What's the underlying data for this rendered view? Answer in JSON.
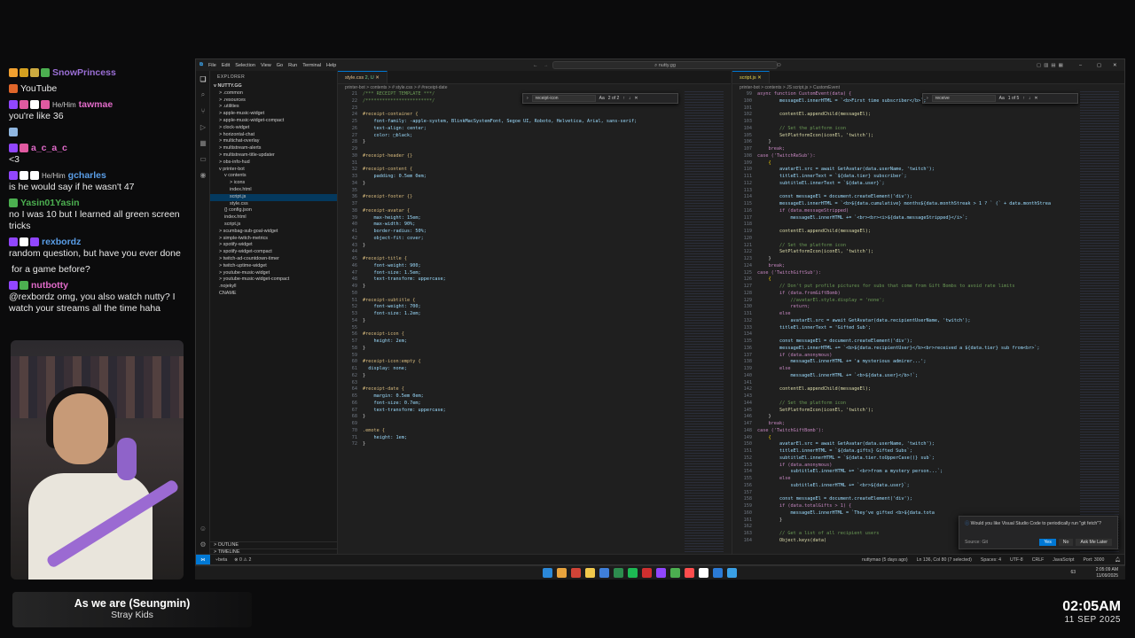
{
  "chat": [
    {
      "user": "SnowPrincess",
      "color": "#9b6fd6",
      "pronouns": "",
      "badges": [
        "#f0a030",
        "#d4a020",
        "#ccaa40",
        "#4caf50"
      ],
      "text": ""
    },
    {
      "user": "",
      "color": "#ffffff",
      "pronouns": "",
      "badges": [
        "#e0662a"
      ],
      "text": "YouTube"
    },
    {
      "user": "tawmae",
      "color": "#e06ac8",
      "pronouns": "He/Him",
      "badges": [
        "#9146ff",
        "#e05aa0",
        "#ffffff",
        "#e05aa0"
      ],
      "text": "you're like 36"
    },
    {
      "user": "",
      "color": "#ffffff",
      "pronouns": "",
      "badges": [
        "#8fb6e0"
      ],
      "text": ""
    },
    {
      "user": "a_c_a_c",
      "color": "#e06ac8",
      "pronouns": "",
      "badges": [
        "#9146ff",
        "#e05aa0"
      ],
      "text": "<3"
    },
    {
      "user": "gcharles",
      "color": "#5a9ee8",
      "pronouns": "He/Him",
      "badges": [
        "#9146ff",
        "#ffffff",
        "#ffffff"
      ],
      "text": "is  he would say if he wasn't 47"
    },
    {
      "user": "Yasin01Yasin",
      "color": "#4caf50",
      "pronouns": "",
      "badges": [
        "#4caf50"
      ],
      "text": "no I was 10 but I learned all green screen tricks"
    },
    {
      "user": "rexbordz",
      "color": "#5a9ee8",
      "pronouns": "",
      "badges": [
        "#9146ff",
        "#ffffff",
        "#9146ff"
      ],
      "text": "random question, but have you ever done"
    },
    {
      "user": "",
      "color": "#ffffff",
      "pronouns": "",
      "badges": [],
      "text": "for a game before?"
    },
    {
      "user": "nutbotty",
      "color": "#e06ac8",
      "pronouns": "",
      "badges": [
        "#9146ff",
        "#4caf50"
      ],
      "text": "@rexbordz omg, you also watch nutty? I watch your streams all the time haha"
    }
  ],
  "now_playing": {
    "title": "As we are (Seungmin)",
    "artist": "Stray Kids"
  },
  "clock": {
    "time": "02:05AM",
    "date": "11 SEP 2025"
  },
  "vscode": {
    "menu": [
      "File",
      "Edit",
      "Selection",
      "View",
      "Go",
      "Run",
      "Terminal",
      "Help"
    ],
    "search": "nutty.gg",
    "explorer_title": "EXPLORER",
    "root": "NUTTY.GG",
    "tree": [
      {
        "label": "> .common",
        "depth": 1
      },
      {
        "label": "> .resources",
        "depth": 1
      },
      {
        "label": "> .utilities",
        "depth": 1
      },
      {
        "label": "> apple-music-widget",
        "depth": 1
      },
      {
        "label": "> apple-music-widget-compact",
        "depth": 1
      },
      {
        "label": "> clock-widget",
        "depth": 1
      },
      {
        "label": "> horizontal-chat",
        "depth": 1
      },
      {
        "label": "> multichat-overlay",
        "depth": 1
      },
      {
        "label": "> multistream-alerts",
        "depth": 1
      },
      {
        "label": "> multistream-title-updater",
        "depth": 1
      },
      {
        "label": "> obs-info-hud",
        "depth": 1
      },
      {
        "label": "v printer-bot",
        "depth": 1
      },
      {
        "label": "v contents",
        "depth": 2
      },
      {
        "label": "> icons",
        "depth": 3
      },
      {
        "label": "index.html",
        "depth": 3
      },
      {
        "label": "script.js",
        "depth": 3,
        "sel": true
      },
      {
        "label": "style.css",
        "depth": 3
      },
      {
        "label": "{} config.json",
        "depth": 2
      },
      {
        "label": "index.html",
        "depth": 2
      },
      {
        "label": "script.js",
        "depth": 2
      },
      {
        "label": "> scumbag-sub-goal-widget",
        "depth": 1
      },
      {
        "label": "> simple-twitch-metrics",
        "depth": 1
      },
      {
        "label": "> spotify-widget",
        "depth": 1
      },
      {
        "label": "> spotify-widget-compact",
        "depth": 1
      },
      {
        "label": "> twitch-ad-countdown-timer",
        "depth": 1
      },
      {
        "label": "> twitch-uptime-widget",
        "depth": 1
      },
      {
        "label": "> youtube-music-widget",
        "depth": 1
      },
      {
        "label": "> youtube-music-widget-compact",
        "depth": 1
      },
      {
        "label": ".nojekyll",
        "depth": 1
      },
      {
        "label": "CNAME",
        "depth": 1
      }
    ],
    "outline": "OUTLINE",
    "timeline": "TIMELINE",
    "left_editor": {
      "tab": "style.css",
      "tab_status": "2, U",
      "breadcrumb": "printer-bot > contents > # style.css > # #receipt-date",
      "find": {
        "query": "receipt-icon",
        "count": "2 of 2"
      },
      "lines": [
        {
          "n": "21",
          "t": "/*** RECEIPT TEMPLATE ***/",
          "c": "cmt"
        },
        {
          "n": "22",
          "t": "/************************/",
          "c": "cmt"
        },
        {
          "n": "23",
          "t": "",
          "c": ""
        },
        {
          "n": "24",
          "t": "#receipt-container {",
          "c": "sel_"
        },
        {
          "n": "25",
          "t": "    font-family: -apple-system, BlinkMacSystemFont, Segoe UI, Roboto, Helvetica, Arial, sans-serif;",
          "c": "prop"
        },
        {
          "n": "26",
          "t": "    text-align: center;",
          "c": "prop"
        },
        {
          "n": "27",
          "t": "    color: □black;",
          "c": "prop"
        },
        {
          "n": "28",
          "t": "}",
          "c": ""
        },
        {
          "n": "29",
          "t": "",
          "c": ""
        },
        {
          "n": "30",
          "t": "#receipt-header {}",
          "c": "sel_"
        },
        {
          "n": "31",
          "t": "",
          "c": ""
        },
        {
          "n": "32",
          "t": "#receipt-content {",
          "c": "sel_"
        },
        {
          "n": "33",
          "t": "    padding: 0.5em 0em;",
          "c": "prop"
        },
        {
          "n": "34",
          "t": "}",
          "c": ""
        },
        {
          "n": "35",
          "t": "",
          "c": ""
        },
        {
          "n": "36",
          "t": "#receipt-footer {}",
          "c": "sel_"
        },
        {
          "n": "37",
          "t": "",
          "c": ""
        },
        {
          "n": "38",
          "t": "#receipt-avatar {",
          "c": "sel_"
        },
        {
          "n": "39",
          "t": "    max-height: 15em;",
          "c": "prop"
        },
        {
          "n": "40",
          "t": "    max-width: 90%;",
          "c": "prop"
        },
        {
          "n": "41",
          "t": "    border-radius: 50%;",
          "c": "prop"
        },
        {
          "n": "42",
          "t": "    object-fit: cover;",
          "c": "prop"
        },
        {
          "n": "43",
          "t": "}",
          "c": ""
        },
        {
          "n": "44",
          "t": "",
          "c": ""
        },
        {
          "n": "45",
          "t": "#receipt-title {",
          "c": "sel_"
        },
        {
          "n": "46",
          "t": "    font-weight: 900;",
          "c": "prop"
        },
        {
          "n": "47",
          "t": "    font-size: 1.5em;",
          "c": "prop"
        },
        {
          "n": "48",
          "t": "    text-transform: uppercase;",
          "c": "prop"
        },
        {
          "n": "49",
          "t": "}",
          "c": ""
        },
        {
          "n": "50",
          "t": "",
          "c": ""
        },
        {
          "n": "51",
          "t": "#receipt-subtitle {",
          "c": "sel_"
        },
        {
          "n": "52",
          "t": "    font-weight: 700;",
          "c": "prop"
        },
        {
          "n": "53",
          "t": "    font-size: 1.2em;",
          "c": "prop"
        },
        {
          "n": "54",
          "t": "}",
          "c": ""
        },
        {
          "n": "55",
          "t": "",
          "c": ""
        },
        {
          "n": "56",
          "t": "#receipt-icon {",
          "c": "sel_"
        },
        {
          "n": "57",
          "t": "    height: 2em;",
          "c": "prop"
        },
        {
          "n": "58",
          "t": "}",
          "c": ""
        },
        {
          "n": "59",
          "t": "",
          "c": ""
        },
        {
          "n": "60",
          "t": "#receipt-icon:empty {",
          "c": "sel_"
        },
        {
          "n": "61",
          "t": "  display: none;",
          "c": "prop"
        },
        {
          "n": "62",
          "t": "}",
          "c": ""
        },
        {
          "n": "63",
          "t": "",
          "c": ""
        },
        {
          "n": "64",
          "t": "#receipt-date {",
          "c": "sel_"
        },
        {
          "n": "65",
          "t": "    margin: 0.5em 0em;",
          "c": "prop"
        },
        {
          "n": "66",
          "t": "    font-size: 0.7em;",
          "c": "prop"
        },
        {
          "n": "67",
          "t": "    text-transform: uppercase;",
          "c": "prop"
        },
        {
          "n": "68",
          "t": "}",
          "c": ""
        },
        {
          "n": "69",
          "t": "",
          "c": ""
        },
        {
          "n": "70",
          "t": ".emote {",
          "c": "sel_"
        },
        {
          "n": "71",
          "t": "    height: 1em;",
          "c": "prop"
        },
        {
          "n": "72",
          "t": "}",
          "c": ""
        }
      ]
    },
    "right_editor": {
      "tab": "script.js",
      "tab_status": "",
      "breadcrumb": "printer-bot > contents > JS script.js > CustomEvent",
      "find": {
        "query": "receive",
        "count": "1 of 5"
      },
      "lines": [
        {
          "n": "99",
          "t": "async function CustomEvent(data) {",
          "c": "kw"
        },
        {
          "n": "100",
          "t": "        messageEl.innerHTML = `<b>First time subscriber</b>`;",
          "c": "prop"
        },
        {
          "n": "101",
          "t": "",
          "c": ""
        },
        {
          "n": "102",
          "t": "        contentEl.appendChild(messageEl);",
          "c": "fn"
        },
        {
          "n": "103",
          "t": "",
          "c": ""
        },
        {
          "n": "104",
          "t": "        // Set the platform icon",
          "c": "cmt"
        },
        {
          "n": "105",
          "t": "        SetPlatformIcon(iconEl, 'twitch');",
          "c": "fn"
        },
        {
          "n": "106",
          "t": "    }",
          "c": ""
        },
        {
          "n": "107",
          "t": "    break;",
          "c": "kw"
        },
        {
          "n": "108",
          "t": "case ('TwitchReSub'):",
          "c": "kw"
        },
        {
          "n": "109",
          "t": "    {",
          "c": "brc"
        },
        {
          "n": "110",
          "t": "        avatarEl.src = await GetAvatar(data.userName, 'twitch');",
          "c": "prop"
        },
        {
          "n": "111",
          "t": "        titleEl.innerText = `${data.tier} subscriber`;",
          "c": "prop"
        },
        {
          "n": "112",
          "t": "        subtitleEl.innerText = `${data.user}`;",
          "c": "prop"
        },
        {
          "n": "113",
          "t": "",
          "c": ""
        },
        {
          "n": "114",
          "t": "        const messageEl = document.createElement('div');",
          "c": "prop"
        },
        {
          "n": "115",
          "t": "        messageEl.innerHTML = `<b>${data.cumulative} months${data.monthStreak > 1 ? ` (` + data.monthStrea",
          "c": "prop"
        },
        {
          "n": "116",
          "t": "        if (data.messageStripped)",
          "c": "kw"
        },
        {
          "n": "117",
          "t": "            messageEl.innerHTML += `<br><br><i>${data.messageStripped}</i>`;",
          "c": "prop"
        },
        {
          "n": "118",
          "t": "",
          "c": ""
        },
        {
          "n": "119",
          "t": "        contentEl.appendChild(messageEl);",
          "c": "fn"
        },
        {
          "n": "120",
          "t": "",
          "c": ""
        },
        {
          "n": "121",
          "t": "        // Set the platform icon",
          "c": "cmt"
        },
        {
          "n": "122",
          "t": "        SetPlatformIcon(iconEl, 'twitch');",
          "c": "fn"
        },
        {
          "n": "123",
          "t": "    }",
          "c": ""
        },
        {
          "n": "124",
          "t": "    break;",
          "c": "kw"
        },
        {
          "n": "125",
          "t": "case ('TwitchGiftSub'):",
          "c": "kw"
        },
        {
          "n": "126",
          "t": "    {",
          "c": "brc"
        },
        {
          "n": "127",
          "t": "        // Don't put profile pictures for subs that come from Gift Bombs to avoid rate limits",
          "c": "cmt"
        },
        {
          "n": "128",
          "t": "        if (data.fromGiftBomb)",
          "c": "kw"
        },
        {
          "n": "129",
          "t": "            //avatarEl.style.display = 'none';",
          "c": "cmt"
        },
        {
          "n": "130",
          "t": "            return;",
          "c": "kw"
        },
        {
          "n": "131",
          "t": "        else",
          "c": "kw"
        },
        {
          "n": "132",
          "t": "            avatarEl.src = await GetAvatar(data.recipientUserName, 'twitch');",
          "c": "prop"
        },
        {
          "n": "133",
          "t": "        titleEl.innerText = 'Gifted Sub';",
          "c": "prop"
        },
        {
          "n": "134",
          "t": "",
          "c": ""
        },
        {
          "n": "135",
          "t": "        const messageEl = document.createElement('div');",
          "c": "prop"
        },
        {
          "n": "136",
          "t": "        messageEl.innerHTML += `<b>${data.recipientUser}</b><br>received a ${data.tier} sub from<br>`;",
          "c": "prop"
        },
        {
          "n": "137",
          "t": "        if (data.anonymous)",
          "c": "kw"
        },
        {
          "n": "138",
          "t": "            messageEl.innerHTML += 'a mysterious admirer...';",
          "c": "prop"
        },
        {
          "n": "139",
          "t": "        else",
          "c": "kw"
        },
        {
          "n": "140",
          "t": "            messageEl.innerHTML += `<b>${data.user}</b>!`;",
          "c": "prop"
        },
        {
          "n": "141",
          "t": "",
          "c": ""
        },
        {
          "n": "142",
          "t": "        contentEl.appendChild(messageEl);",
          "c": "fn"
        },
        {
          "n": "143",
          "t": "",
          "c": ""
        },
        {
          "n": "144",
          "t": "        // Set the platform icon",
          "c": "cmt"
        },
        {
          "n": "145",
          "t": "        SetPlatformIcon(iconEl, 'twitch');",
          "c": "fn"
        },
        {
          "n": "146",
          "t": "    }",
          "c": ""
        },
        {
          "n": "147",
          "t": "    break;",
          "c": "kw"
        },
        {
          "n": "148",
          "t": "case ('TwitchGiftBomb'):",
          "c": "kw"
        },
        {
          "n": "149",
          "t": "    {",
          "c": "brc"
        },
        {
          "n": "150",
          "t": "        avatarEl.src = await GetAvatar(data.userName, 'twitch');",
          "c": "prop"
        },
        {
          "n": "151",
          "t": "        titleEl.innerHTML = `${data.gifts} Gifted Subs`;",
          "c": "prop"
        },
        {
          "n": "152",
          "t": "        subtitleEl.innerHTML = `${data.tier.toUpperCase()} sub`;",
          "c": "prop"
        },
        {
          "n": "153",
          "t": "        if (data.anonymous)",
          "c": "kw"
        },
        {
          "n": "154",
          "t": "            subtitleEl.innerHTML += `<br>from a mystery person...`;",
          "c": "prop"
        },
        {
          "n": "155",
          "t": "        else",
          "c": "kw"
        },
        {
          "n": "156",
          "t": "            subtitleEl.innerHTML += `<br>${data.user}`;",
          "c": "prop"
        },
        {
          "n": "157",
          "t": "",
          "c": ""
        },
        {
          "n": "158",
          "t": "        const messageEl = document.createElement('div');",
          "c": "prop"
        },
        {
          "n": "159",
          "t": "        if (data.totalGifts > 1) {",
          "c": "kw"
        },
        {
          "n": "160",
          "t": "            messageEl.innerHTML = `They've gifted <b>${data.tota",
          "c": "prop"
        },
        {
          "n": "161",
          "t": "        }",
          "c": ""
        },
        {
          "n": "162",
          "t": "",
          "c": ""
        },
        {
          "n": "163",
          "t": "        // Get a list of all recipient users",
          "c": "cmt"
        },
        {
          "n": "164",
          "t": "        Object.keys(data)",
          "c": "fn"
        }
      ]
    },
    "notification": {
      "text": "Would you like Visual Studio Code to periodically run \"git fetch\"?",
      "source": "Source: Git",
      "yes": "Yes",
      "no": "No",
      "ask": "Ask Me Later"
    },
    "status": {
      "branch": "beta",
      "errors": "⊗ 0 ⚠ 2",
      "author": "nuttymao (5 days ago)",
      "position": "Ln 136, Col 80 (7 selected)",
      "spaces": "Spaces: 4",
      "encoding": "UTF-8",
      "eol": "CRLF",
      "language": "JavaScript",
      "port": "Port: 3000"
    }
  },
  "taskbar": {
    "weather": "63",
    "time": "2:05:09 AM",
    "date": "11/09/2025",
    "app_colors": [
      "#2b88d8",
      "#e8a33d",
      "#d04437",
      "#f2c94c",
      "#3f7fd9",
      "#2d8c4e",
      "#1db954",
      "#cf2f2f",
      "#9146ff",
      "#4caf50",
      "#ff4d4d",
      "#ffffff",
      "#2b7bd6",
      "#3aa0e6"
    ]
  }
}
